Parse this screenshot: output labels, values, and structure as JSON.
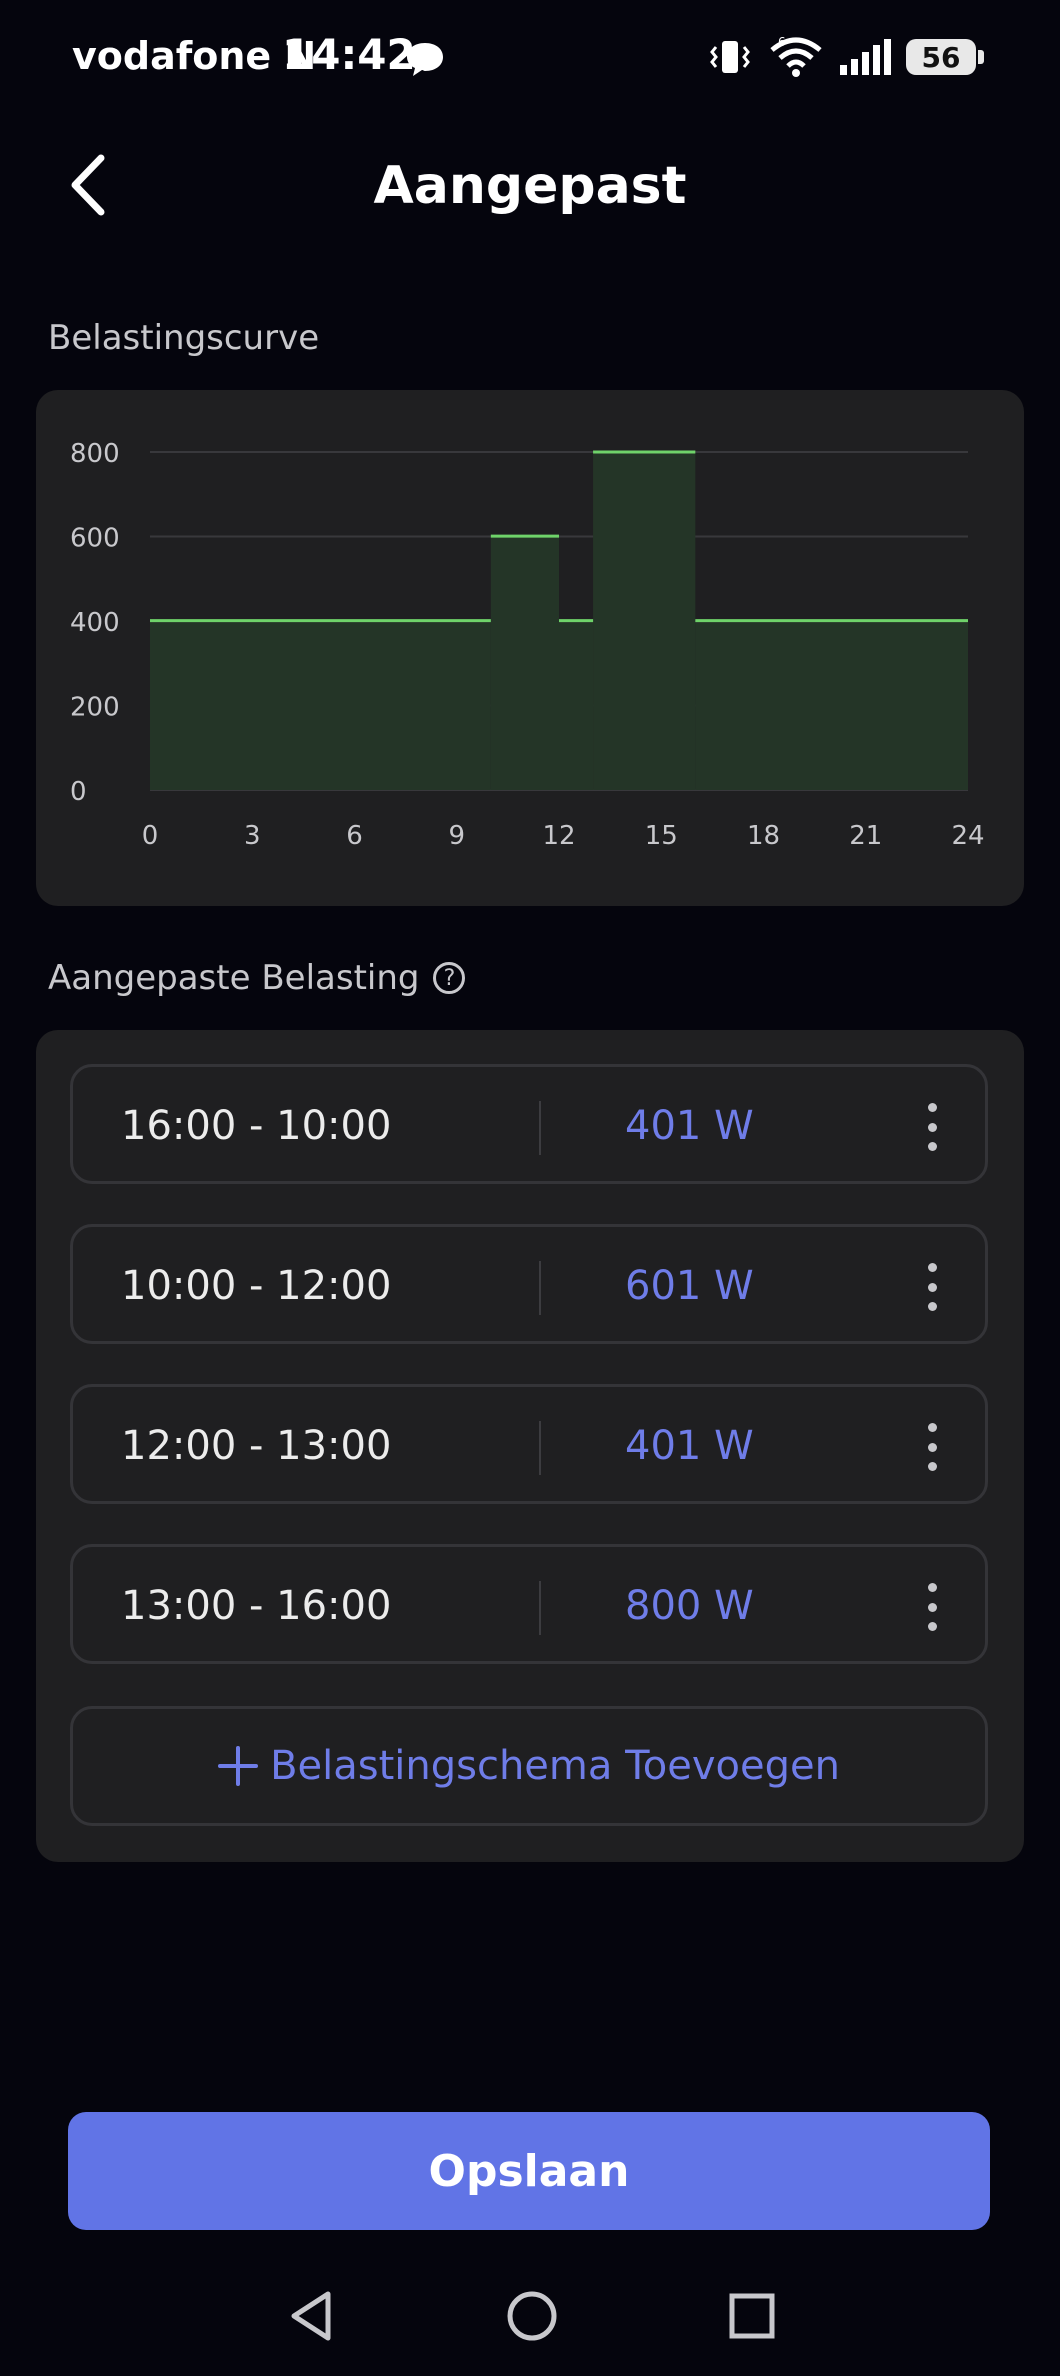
{
  "status_bar": {
    "carrier": "vodafone N",
    "time": "14:42",
    "battery": "56",
    "network_badge": "6"
  },
  "header": {
    "title": "Aangepast"
  },
  "chart_section": {
    "label": "Belastingscurve"
  },
  "chart_data": {
    "type": "area",
    "step": true,
    "x_ticks": [
      "0",
      "3",
      "6",
      "9",
      "12",
      "15",
      "18",
      "21",
      "24"
    ],
    "y_ticks": [
      "0",
      "200",
      "400",
      "600",
      "800"
    ],
    "xlim": [
      0,
      24
    ],
    "ylim": [
      0,
      800
    ],
    "grid": true,
    "segments": [
      {
        "start": 0,
        "end": 10,
        "value": 401
      },
      {
        "start": 10,
        "end": 12,
        "value": 601
      },
      {
        "start": 12,
        "end": 13,
        "value": 401
      },
      {
        "start": 13,
        "end": 16,
        "value": 800
      },
      {
        "start": 16,
        "end": 24,
        "value": 401
      }
    ],
    "line_color": "#6fd36a",
    "fill_color": "#243527"
  },
  "schedule_section": {
    "label": "Aangepaste Belasting",
    "help_symbol": "?",
    "items": [
      {
        "time": "16:00 - 10:00",
        "power": "401 W"
      },
      {
        "time": "10:00 - 12:00",
        "power": "601 W"
      },
      {
        "time": "12:00 - 13:00",
        "power": "401 W"
      },
      {
        "time": "13:00 - 16:00",
        "power": "800 W"
      }
    ],
    "add_label": "Belastingschema Toevoegen"
  },
  "actions": {
    "save_label": "Opslaan"
  },
  "colors": {
    "accent": "#6174e6",
    "power_text": "#6f7de8",
    "background": "#05050d",
    "card": "#1f1f21"
  },
  "icons": {
    "back": "chevron-left-icon",
    "help": "question-circle-icon",
    "row_menu": "more-vertical-icon",
    "add": "plus-icon"
  }
}
